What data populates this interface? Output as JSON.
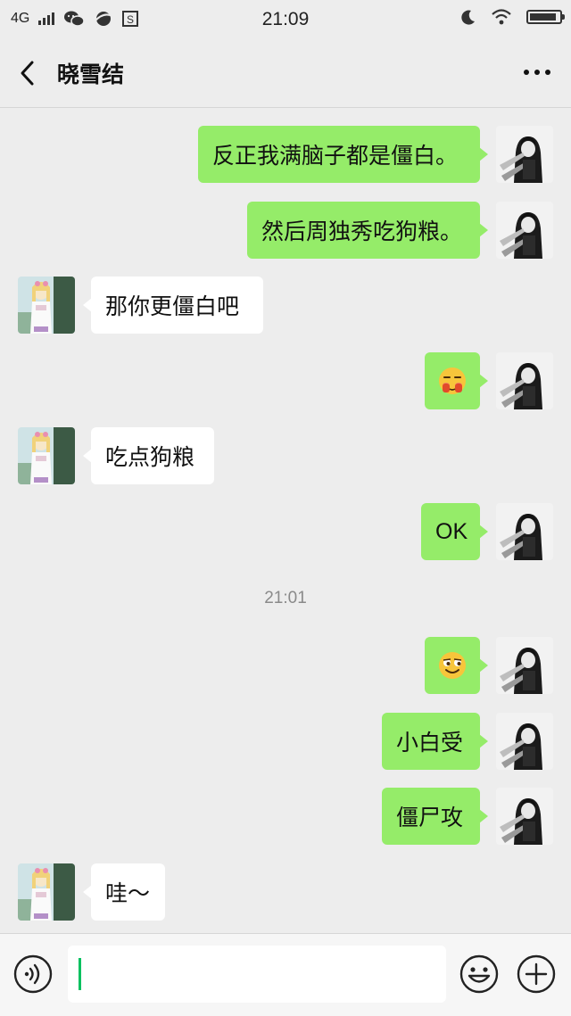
{
  "status_bar": {
    "network": "4G",
    "time": "21:09",
    "battery_level": 0.92,
    "icons": [
      "signal-icon",
      "wechat-icon",
      "browser-icon",
      "s-app-icon",
      "moon-icon",
      "wifi-icon",
      "battery-icon"
    ]
  },
  "header": {
    "title": "晓雪结",
    "back_icon": "chevron-left-icon",
    "more_icon": "more-dots-icon"
  },
  "colors": {
    "background": "#ededed",
    "my_bubble": "#95ec69",
    "their_bubble": "#ffffff",
    "accent": "#07c160"
  },
  "messages": [
    {
      "sender": "me",
      "text": "反正我满脑子都是僵白。"
    },
    {
      "sender": "me",
      "text": "然后周独秀吃狗粮。"
    },
    {
      "sender": "other",
      "text": "那你更僵白吧"
    },
    {
      "sender": "me",
      "emoji": "blushing-covering-face-emoji"
    },
    {
      "sender": "other",
      "text": "吃点狗粮"
    },
    {
      "sender": "me",
      "text": "OK"
    },
    {
      "timestamp": "21:01"
    },
    {
      "sender": "me",
      "emoji": "sly-smile-emoji"
    },
    {
      "sender": "me",
      "text": "小白受"
    },
    {
      "sender": "me",
      "text": "僵尸攻"
    },
    {
      "sender": "other",
      "text": "哇～"
    }
  ],
  "input_bar": {
    "text": "",
    "voice_icon": "voice-icon",
    "emoji_icon": "emoji-icon",
    "plus_icon": "plus-icon"
  }
}
